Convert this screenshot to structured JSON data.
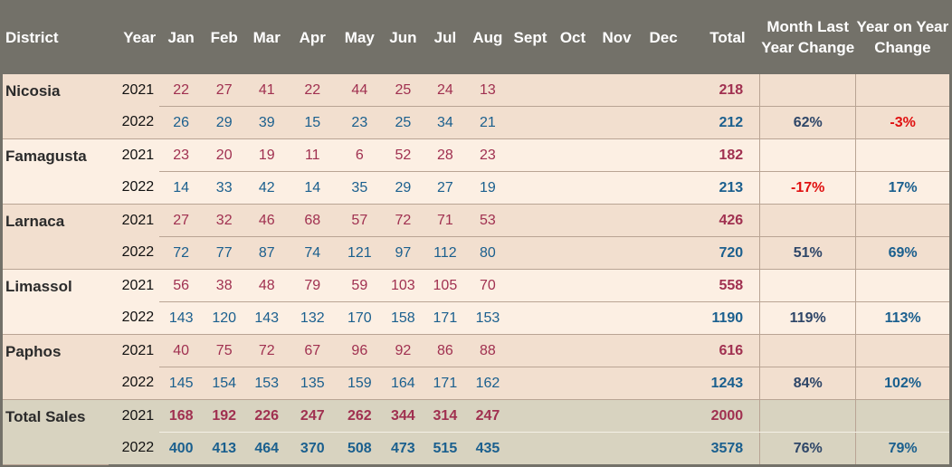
{
  "headers": {
    "district": "District",
    "year": "Year",
    "months": [
      "Jan",
      "Feb",
      "Mar",
      "Apr",
      "May",
      "Jun",
      "Jul",
      "Aug",
      "Sept",
      "Oct",
      "Nov",
      "Dec"
    ],
    "total": "Total",
    "mly": "Month Last Year Change",
    "yoy": "Year on Year Change"
  },
  "groups": [
    {
      "district": "Nicosia",
      "rows": [
        {
          "year": "2021",
          "values": [
            "22",
            "27",
            "41",
            "22",
            "44",
            "25",
            "24",
            "13"
          ],
          "total": "218",
          "mly": "",
          "yoy": ""
        },
        {
          "year": "2022",
          "values": [
            "26",
            "29",
            "39",
            "15",
            "23",
            "25",
            "34",
            "21"
          ],
          "total": "212",
          "mly": "62%",
          "yoy": "-3%"
        }
      ]
    },
    {
      "district": "Famagusta",
      "rows": [
        {
          "year": "2021",
          "values": [
            "23",
            "20",
            "19",
            "11",
            "6",
            "52",
            "28",
            "23"
          ],
          "total": "182",
          "mly": "",
          "yoy": ""
        },
        {
          "year": "2022",
          "values": [
            "14",
            "33",
            "42",
            "14",
            "35",
            "29",
            "27",
            "19"
          ],
          "total": "213",
          "mly": "-17%",
          "yoy": "17%"
        }
      ]
    },
    {
      "district": "Larnaca",
      "rows": [
        {
          "year": "2021",
          "values": [
            "27",
            "32",
            "46",
            "68",
            "57",
            "72",
            "71",
            "53"
          ],
          "total": "426",
          "mly": "",
          "yoy": ""
        },
        {
          "year": "2022",
          "values": [
            "72",
            "77",
            "87",
            "74",
            "121",
            "97",
            "112",
            "80"
          ],
          "total": "720",
          "mly": "51%",
          "yoy": "69%"
        }
      ]
    },
    {
      "district": "Limassol",
      "rows": [
        {
          "year": "2021",
          "values": [
            "56",
            "38",
            "48",
            "79",
            "59",
            "103",
            "105",
            "70"
          ],
          "total": "558",
          "mly": "",
          "yoy": ""
        },
        {
          "year": "2022",
          "values": [
            "143",
            "120",
            "143",
            "132",
            "170",
            "158",
            "171",
            "153"
          ],
          "total": "1190",
          "mly": "119%",
          "yoy": "113%"
        }
      ]
    },
    {
      "district": "Paphos",
      "rows": [
        {
          "year": "2021",
          "values": [
            "40",
            "75",
            "72",
            "67",
            "96",
            "92",
            "86",
            "88"
          ],
          "total": "616",
          "mly": "",
          "yoy": ""
        },
        {
          "year": "2022",
          "values": [
            "145",
            "154",
            "153",
            "135",
            "159",
            "164",
            "171",
            "162"
          ],
          "total": "1243",
          "mly": "84%",
          "yoy": "102%"
        }
      ]
    },
    {
      "district": "Total Sales",
      "rows": [
        {
          "year": "2021",
          "values": [
            "168",
            "192",
            "226",
            "247",
            "262",
            "344",
            "314",
            "247"
          ],
          "total": "2000",
          "mly": "",
          "yoy": ""
        },
        {
          "year": "2022",
          "values": [
            "400",
            "413",
            "464",
            "370",
            "508",
            "473",
            "515",
            "435"
          ],
          "total": "3578",
          "mly": "76%",
          "yoy": "79%"
        }
      ]
    }
  ],
  "colors": {
    "header_bg": "#737169",
    "red": "#a03050",
    "blue": "#1a5f8e",
    "negative": "#e01010"
  }
}
